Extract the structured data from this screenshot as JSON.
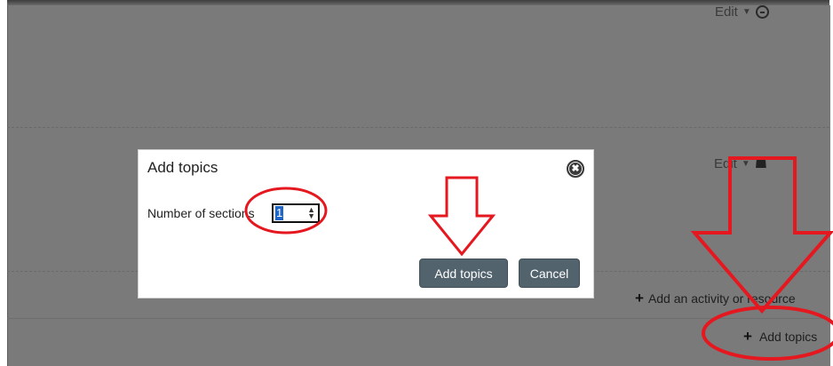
{
  "background": {
    "edit_top": "Edit",
    "edit_mid": "Edit",
    "add_activity": "Add an activity or resource",
    "add_topics": "Add topics"
  },
  "modal": {
    "title": "Add topics",
    "field_label": "Number of sections",
    "field_value": "1",
    "primary_button": "Add topics",
    "cancel_button": "Cancel"
  },
  "icons": {
    "user": "user-circle-icon",
    "person": "person-icon",
    "close": "close-circle-icon",
    "plus": "plus-icon",
    "caret": "caret-down-icon"
  },
  "colors": {
    "overlay": "#7a7a7a",
    "button": "#53636e",
    "annotation": "#e5171f"
  }
}
